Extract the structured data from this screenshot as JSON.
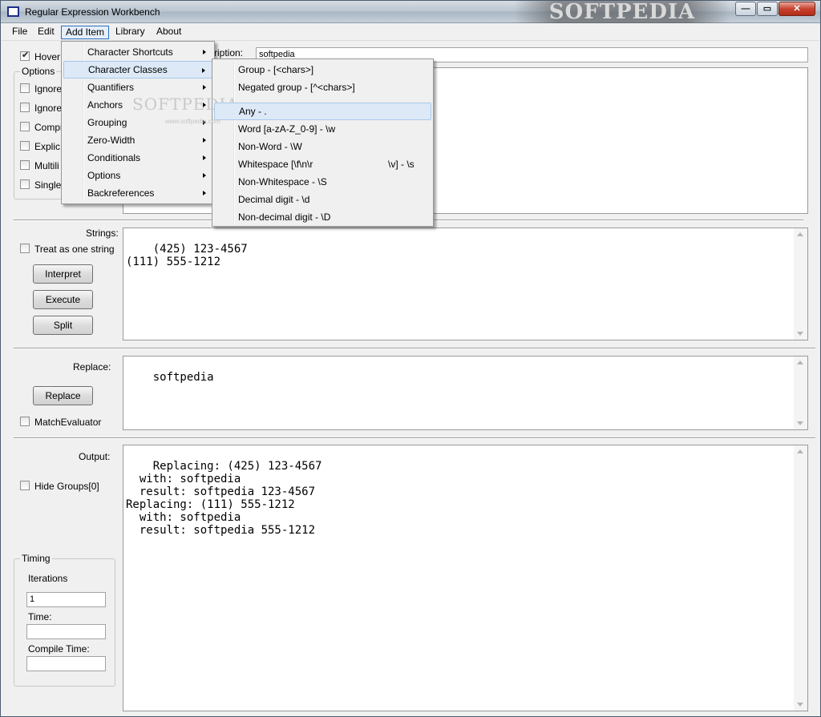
{
  "window": {
    "title": "Regular Expression Workbench",
    "watermark": "SOFTPEDIA",
    "controls": {
      "minimize": "—",
      "maximize": "▭",
      "close": "✕"
    }
  },
  "menubar": [
    "File",
    "Edit",
    "Add Item",
    "Library",
    "About"
  ],
  "top_panel": {
    "hover_label": "Hover",
    "description_label": "ription:",
    "description_value": "softpedia",
    "options_title": "Options",
    "options": [
      "Ignore",
      "Ignore",
      "Compi",
      "Explic",
      "Multili",
      "Single"
    ]
  },
  "strings_panel": {
    "label": "Strings:",
    "treat_label": "Treat as one string",
    "buttons": [
      "Interpret",
      "Execute",
      "Split"
    ],
    "text": "(425) 123-4567\n(111) 555-1212"
  },
  "replace_panel": {
    "label": "Replace:",
    "button": "Replace",
    "match_evaluator": "MatchEvaluator",
    "text": "softpedia"
  },
  "output_panel": {
    "label": "Output:",
    "hide_groups": "Hide Groups[0]",
    "text": "Replacing: (425) 123-4567\n  with: softpedia\n  result: softpedia 123-4567\nReplacing: (111) 555-1212\n  with: softpedia\n  result: softpedia 555-1212",
    "timing": {
      "title": "Timing",
      "iterations_label": "Iterations",
      "iterations_value": "1",
      "time_label": "Time:",
      "compile_label": "Compile Time:"
    }
  },
  "add_item_menu": [
    "Character Shortcuts",
    "Character Classes",
    "Quantifiers",
    "Anchors",
    "Grouping",
    "Zero-Width",
    "Conditionals",
    "Options",
    "Backreferences"
  ],
  "character_classes_menu": [
    "Group - [<chars>]",
    "Negated group - [^<chars>]",
    "Any - .",
    "Word [a-zA-Z_0-9] - \\w",
    "Non-Word - \\W",
    "Whitespace [\\f\\n\\r",
    "Non-Whitespace - \\S",
    "Decimal digit - \\d",
    "Non-decimal digit - \\D"
  ],
  "whitespace_suffix": "\\v] - \\s",
  "bg_watermark": "SOFTPEDIA",
  "bg_watermark_url": "www.softpedia.com"
}
